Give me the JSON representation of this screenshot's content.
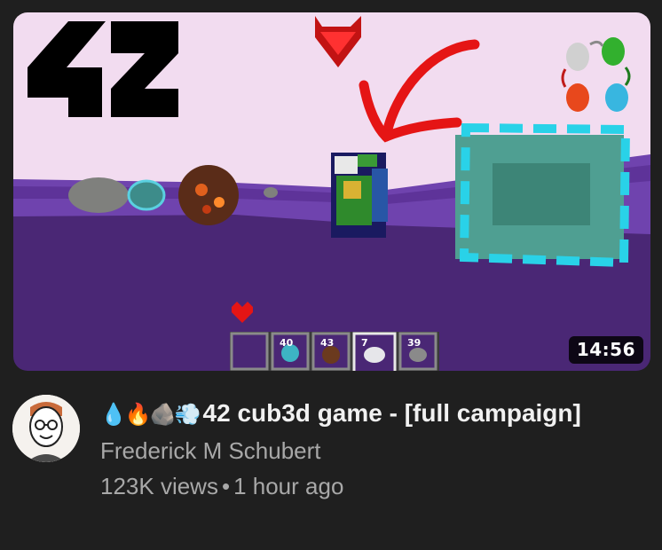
{
  "video": {
    "duration": "14:56",
    "title_emojis": "💧🔥🪨💨",
    "title": "42 cub3d game - [full campaign]",
    "channel": "Frederick M Schubert",
    "views": "123K views",
    "separator": "•",
    "age": "1 hour ago"
  },
  "thumbnail": {
    "logo_text": "42",
    "hotbar": [
      "",
      "40",
      "43",
      "7",
      "39"
    ],
    "colors": {
      "sky": "#f2dcf0",
      "floor": "#4a2775",
      "wall": "#6b3fa8",
      "arrow": "#e51515"
    }
  },
  "icons": {
    "avatar": "avatar-face",
    "play_preview": "thumbnail"
  }
}
